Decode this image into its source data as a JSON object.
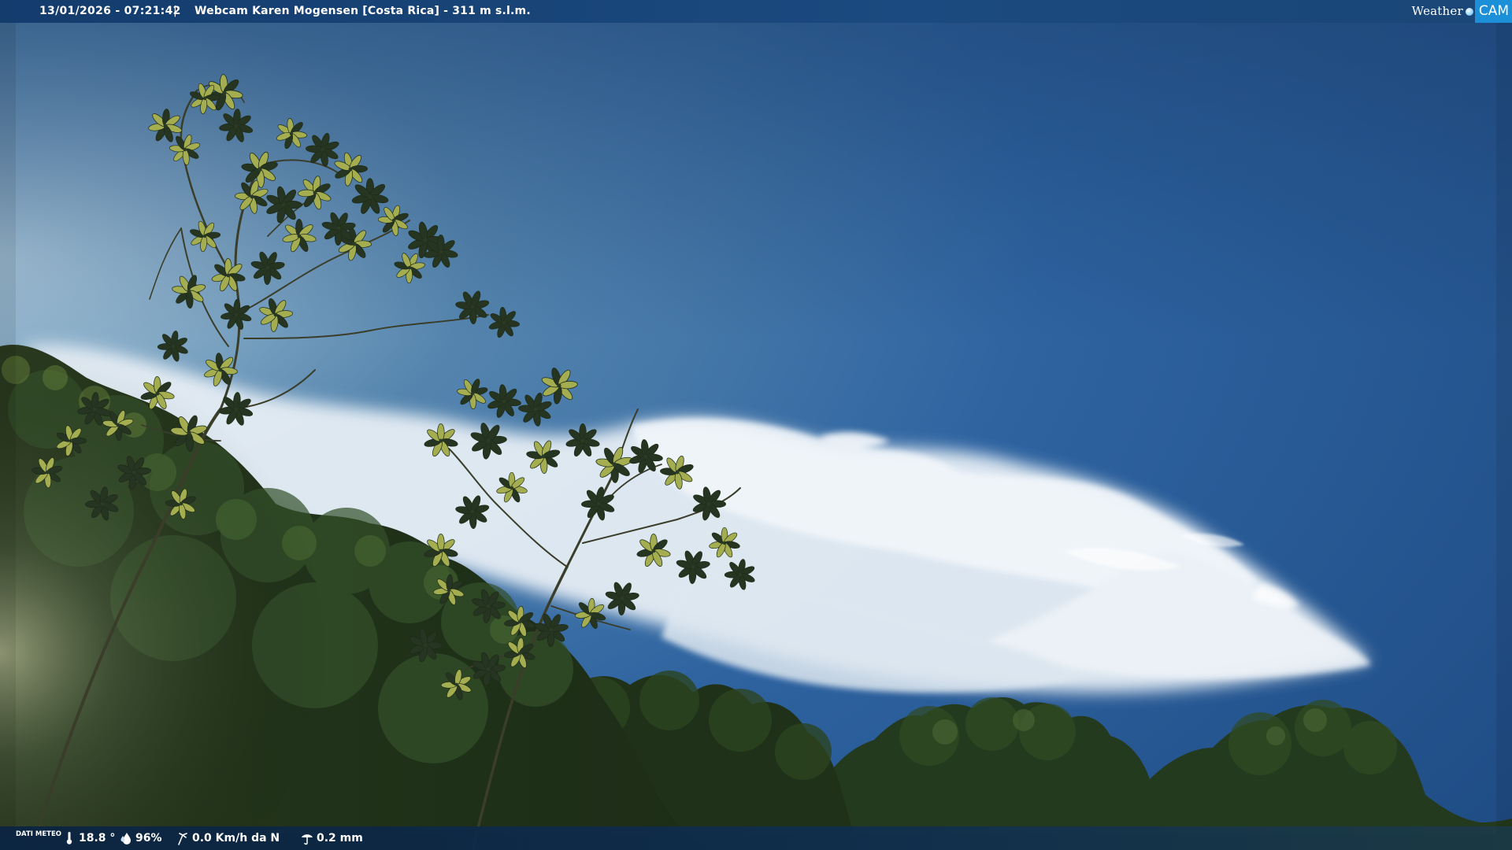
{
  "overlay": {
    "timestamp": "13/01/2026 - 07:21:42",
    "separator": "|",
    "title": "Webcam Karen Mogensen [Costa Rica]  - 311 m s.l.m.",
    "brand_left": "Weather",
    "brand_right": "CAM"
  },
  "weather": {
    "label": "DATI METEO",
    "temperature": "18.8 °",
    "humidity": "96%",
    "wind": "0.0 Km/h da N",
    "rain": "0.2 mm"
  },
  "icons": {
    "temperature": "thermometer-icon",
    "humidity": "drop-icon",
    "wind": "wind-icon",
    "rain": "rain-icon"
  },
  "colors": {
    "sky_top": "#1d4a82",
    "sky_mid": "#2d64a3",
    "foliage_dark": "#1c2e17",
    "foliage_lit": "#a8b451",
    "bar": "#133a6a",
    "brand_accent": "#1b8fd8"
  }
}
